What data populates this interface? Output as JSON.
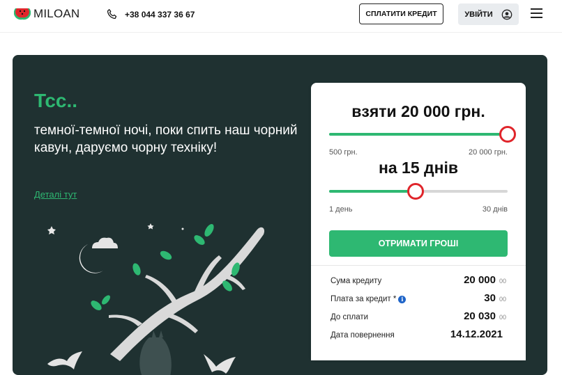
{
  "header": {
    "logo_text": "MILOAN",
    "phone": "+38 044 337 36 67",
    "pay_button": "СПЛАТИТИ КРЕДИТ",
    "login_button": "УВІЙТИ"
  },
  "hero": {
    "title": "Тсс..",
    "text": "темної-темної ночі, поки спить наш чорний кавун, даруємо чорну техніку!",
    "details_link": "Деталі тут"
  },
  "calculator": {
    "amount_line": "взяти 20 000 грн.",
    "amount_min": "500 грн.",
    "amount_max": "20 000 грн.",
    "amount_fraction": 1.0,
    "term_line": "на 15 днів",
    "term_min": "1 день",
    "term_max": "30 днів",
    "term_fraction": 0.483,
    "cta": "ОТРИМАТИ ГРОШІ",
    "summary": [
      {
        "label": "Сума кредиту",
        "value": "20 000",
        "currency": "00",
        "info": false
      },
      {
        "label": "Плата за кредит *",
        "value": "30",
        "currency": "00",
        "info": true
      },
      {
        "label": "До сплати",
        "value": "20 030",
        "currency": "00",
        "info": false
      },
      {
        "label": "Дата повернення",
        "value": "14.12.2021",
        "currency": "",
        "info": false
      }
    ]
  },
  "colors": {
    "accent_green": "#2eb872",
    "hero_bg": "#1f3131",
    "knob_red": "#e0252b"
  }
}
